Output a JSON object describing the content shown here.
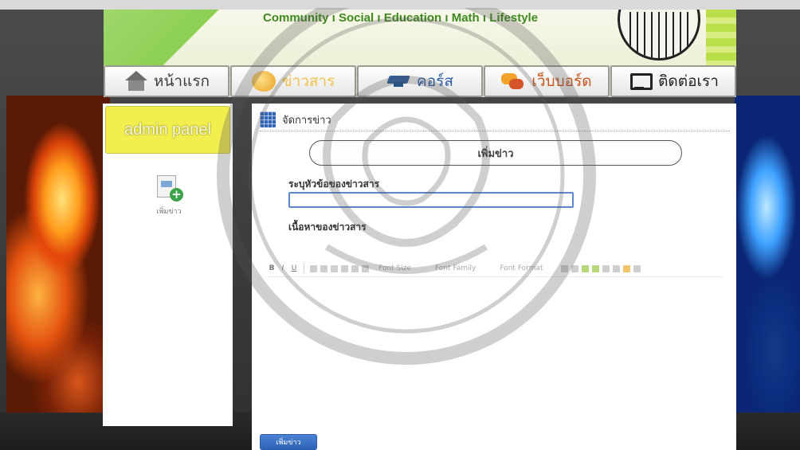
{
  "banner": {
    "title": "Community ı Social ı Education ı Math ı Lifestyle"
  },
  "nav": {
    "tabs": [
      {
        "label": "หน้าแรก",
        "icon": "home-icon"
      },
      {
        "label": "ข่าวสาร",
        "icon": "rss-icon"
      },
      {
        "label": "คอร์ส",
        "icon": "graduation-cap-icon"
      },
      {
        "label": "เว็บบอร์ด",
        "icon": "chat-bubbles-icon"
      },
      {
        "label": "ติดต่อเรา",
        "icon": "monitor-icon"
      }
    ]
  },
  "sidebar": {
    "panel_title": "admin panel",
    "tool_label": "เพิ่มข่าว"
  },
  "main": {
    "section_title": "จัดการข่าว",
    "form_heading": "เพิ่มข่าว",
    "topic_label": "ระบุหัวข้อของข่าวสาร",
    "topic_value": "",
    "content_label": "เนื้อหาของข่าวสาร",
    "toolbar": {
      "bold": "B",
      "italic": "I",
      "underline": "U",
      "font_size": "Font Size",
      "font_family": "Font Family",
      "font_format": "Font Format"
    },
    "submit_label": "เพิ่มข่าว"
  },
  "colors": {
    "admin_panel_bg": "#f1ee4e",
    "nav_course": "#2a5fa6",
    "nav_board": "#c8541a",
    "submit_bg": "#2e62b6"
  }
}
